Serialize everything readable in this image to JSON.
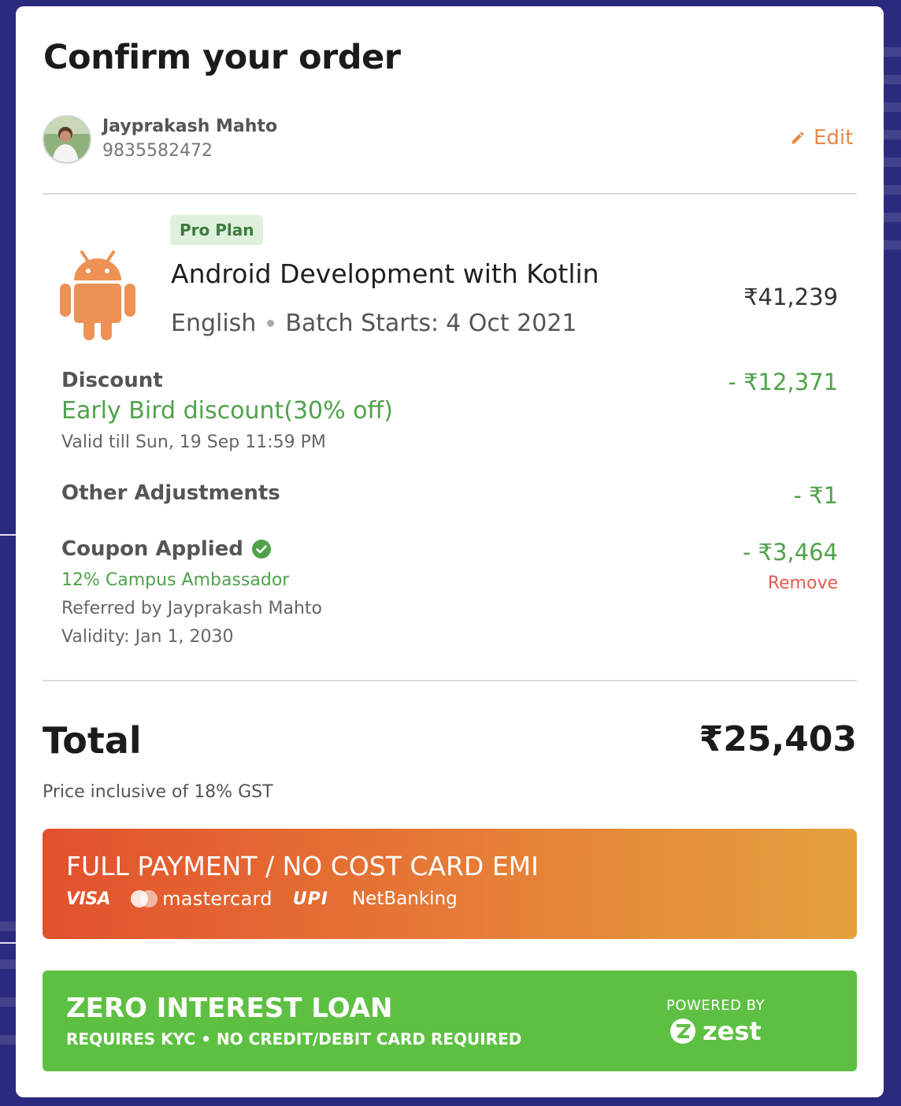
{
  "page": {
    "title": "Confirm your order"
  },
  "user": {
    "name": "Jayprakash Mahto",
    "phone": "9835582472",
    "edit_label": "Edit"
  },
  "course": {
    "badge": "Pro Plan",
    "title": "Android Development with Kotlin",
    "language": "English",
    "batch_label": "Batch Starts:",
    "batch_date": "4 Oct 2021",
    "price": "₹41,239",
    "icon": "android-icon"
  },
  "discount": {
    "label": "Discount",
    "name": "Early Bird discount(30% off)",
    "validity": "Valid till Sun, 19 Sep 11:59 PM",
    "amount": "- ₹12,371"
  },
  "adjustments": {
    "label": "Other Adjustments",
    "amount": "- ₹1"
  },
  "coupon": {
    "label": "Coupon Applied",
    "code": "12% Campus Ambassador",
    "referred_by": "Referred by Jayprakash Mahto",
    "validity": "Validity: Jan 1, 2030",
    "amount": "- ₹3,464",
    "remove_label": "Remove"
  },
  "total": {
    "label": "Total",
    "value": "₹25,403",
    "note": "Price inclusive of 18% GST"
  },
  "full_payment": {
    "title": "FULL PAYMENT / NO COST CARD EMI",
    "methods": {
      "visa": "VISA",
      "mastercard": "mastercard",
      "upi": "UPI",
      "netbanking": "NetBanking"
    }
  },
  "loan": {
    "title": "ZERO INTEREST LOAN",
    "subtitle": "REQUIRES KYC • NO CREDIT/DEBIT CARD REQUIRED",
    "powered_by": "POWERED BY",
    "partner": "zest"
  },
  "colors": {
    "accent_orange": "#e8894a",
    "green": "#4fa24a",
    "red": "#e25b4f",
    "loan_green": "#5ec043",
    "background": "#2a2a7e"
  }
}
